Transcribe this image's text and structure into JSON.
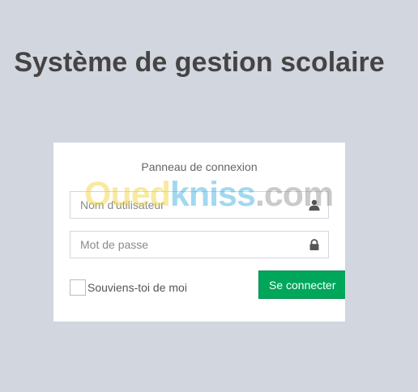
{
  "page": {
    "title": "Système de gestion scolaire"
  },
  "login": {
    "panel_title": "Panneau de connexion",
    "username_placeholder": "Nom d'utilisateur",
    "password_placeholder": "Mot de passe",
    "remember_label": "Souviens-toi de moi",
    "submit_label": "Se connecter",
    "username_icon": "user-icon",
    "password_icon": "lock-icon"
  },
  "watermark": {
    "part1": "Oued",
    "part2": "kniss",
    "part3": ".com"
  },
  "colors": {
    "background": "#d2d6de",
    "button": "#00a65a",
    "title": "#444444"
  }
}
